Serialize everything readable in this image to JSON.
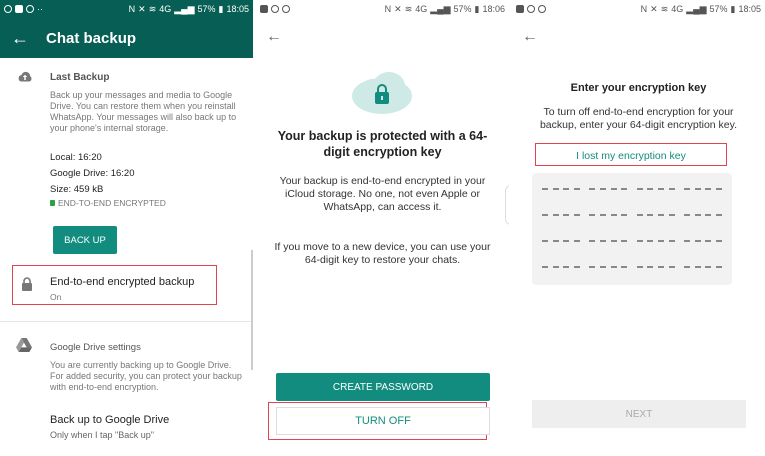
{
  "status": {
    "left_text": "··",
    "battery": "57%",
    "network": "4G",
    "time1": "18:05",
    "time2": "18:06",
    "time3": "18:05"
  },
  "screen1": {
    "title": "Chat backup",
    "last_backup": {
      "title": "Last Backup",
      "desc": "Back up your messages and media to Google Drive. You can restore them when you reinstall WhatsApp. Your messages will also back up to your phone's internal storage.",
      "local": "Local: 16:20",
      "gdrive": "Google Drive: 16:20",
      "size": "Size: 459 kB",
      "e2e": "END-TO-END ENCRYPTED",
      "button": "BACK UP"
    },
    "e2e_row": {
      "title": "End-to-end encrypted backup",
      "sub": "On"
    },
    "gd_settings": {
      "title": "Google Drive settings",
      "desc": "You are currently backing up to Google Drive. For added security, you can protect your backup with end-to-end encryption.",
      "row_title": "Back up to Google Drive",
      "row_sub": "Only when I tap \"Back up\""
    }
  },
  "screen2": {
    "heading": "Your backup is protected with a 64-digit encryption key",
    "text1": "Your backup is end-to-end encrypted in your iCloud storage. No one, not even Apple or WhatsApp, can access it.",
    "text2": "If you move to a new device, you can use your 64-digit key to restore your chats.",
    "create_btn": "CREATE PASSWORD",
    "turnoff_btn": "TURN OFF"
  },
  "screen3": {
    "heading": "Enter your encryption key",
    "text": "To turn off end-to-end encryption for your backup, enter your 64-digit encryption key.",
    "lost_link": "I lost my encryption key",
    "next_btn": "NEXT"
  },
  "colors": {
    "primary": "#075e54",
    "accent": "#128c7e",
    "highlight": "#e0444f"
  },
  "icons": {
    "back": "back-arrow-icon",
    "cloud": "cloud-upload-icon",
    "lock": "lock-icon",
    "drive": "google-drive-icon",
    "cloud_lock": "cloud-lock-icon"
  }
}
